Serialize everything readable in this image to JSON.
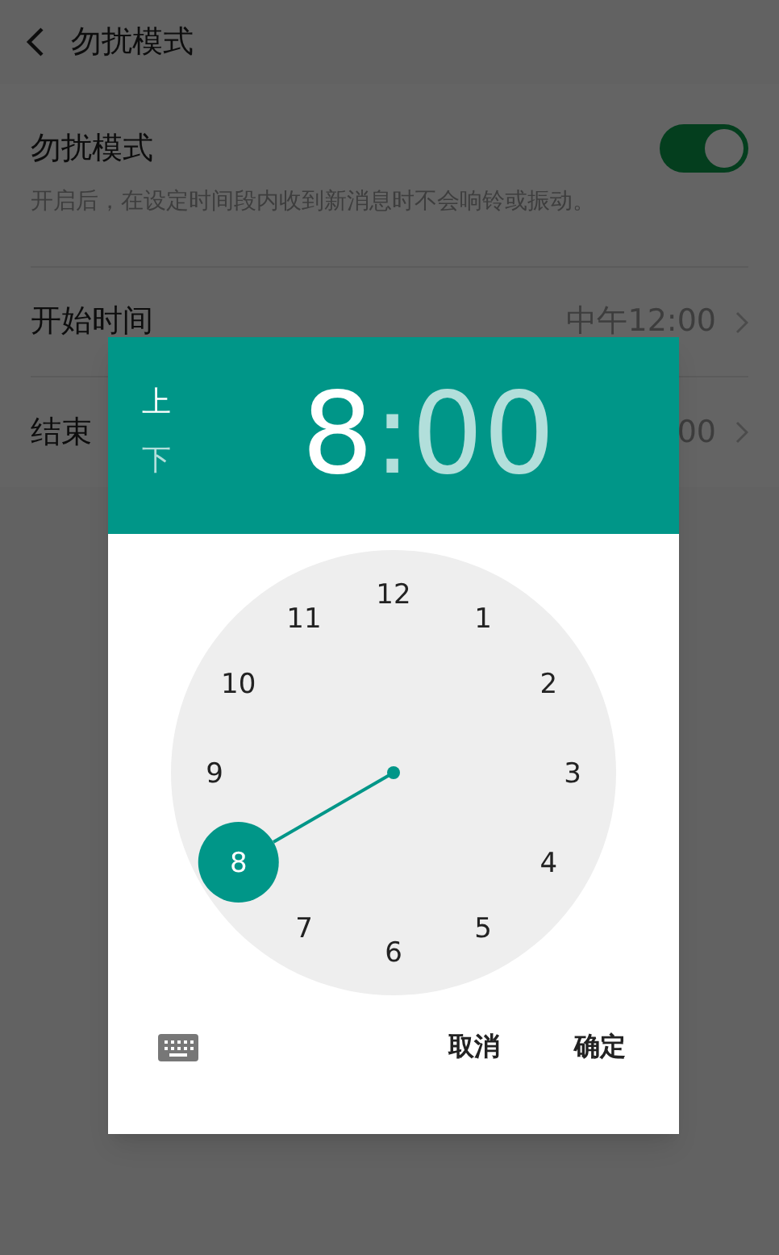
{
  "header": {
    "title": "勿扰模式"
  },
  "settings": [
    {
      "kind": "toggle",
      "label": "勿扰模式",
      "description": "开启后，在设定时间段内收到新消息时不会响铃或振动。",
      "on": true
    },
    {
      "kind": "value",
      "label": "开始时间",
      "value": "中午12:00"
    },
    {
      "kind": "value",
      "label": "结束",
      "value": "00"
    }
  ],
  "dialog": {
    "am_pm": [
      {
        "label": "上",
        "selected": true
      },
      {
        "label": "下",
        "selected": false
      }
    ],
    "hour": {
      "text": "8",
      "selected": true
    },
    "separator": ":",
    "minute": {
      "text": "00",
      "selected": false
    },
    "clock_numbers": [
      {
        "label": "12",
        "selected": false
      },
      {
        "label": "1",
        "selected": false
      },
      {
        "label": "2",
        "selected": false
      },
      {
        "label": "3",
        "selected": false
      },
      {
        "label": "4",
        "selected": false
      },
      {
        "label": "5",
        "selected": false
      },
      {
        "label": "6",
        "selected": false
      },
      {
        "label": "7",
        "selected": false
      },
      {
        "label": "8",
        "selected": true
      },
      {
        "label": "9",
        "selected": false
      },
      {
        "label": "10",
        "selected": false
      },
      {
        "label": "11",
        "selected": false
      }
    ],
    "buttons": [
      "取消",
      "确定"
    ]
  }
}
